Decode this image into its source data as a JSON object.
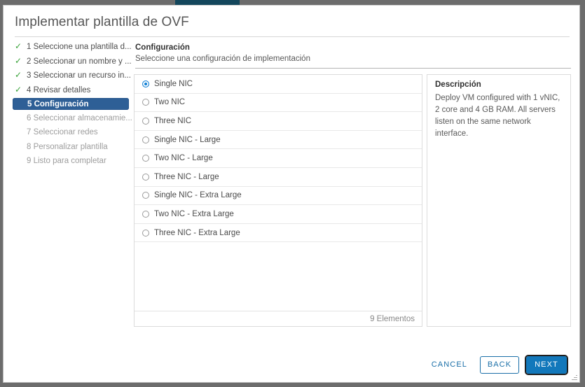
{
  "window": {
    "title": "Implementar plantilla de OVF"
  },
  "steps": [
    {
      "label": "1 Seleccione una plantilla d...",
      "state": "done"
    },
    {
      "label": "2 Seleccionar un nombre y ...",
      "state": "done"
    },
    {
      "label": "3 Seleccionar un recurso in...",
      "state": "done"
    },
    {
      "label": "4 Revisar detalles",
      "state": "done"
    },
    {
      "label": "5 Configuración",
      "state": "current"
    },
    {
      "label": "6 Seleccionar almacenamie...",
      "state": "pending"
    },
    {
      "label": "7 Seleccionar redes",
      "state": "pending"
    },
    {
      "label": "8 Personalizar plantilla",
      "state": "pending"
    },
    {
      "label": "9 Listo para completar",
      "state": "pending"
    }
  ],
  "pane": {
    "title": "Configuración",
    "subtitle": "Seleccione una configuración de implementación"
  },
  "options": {
    "items": [
      {
        "label": "Single NIC",
        "selected": true
      },
      {
        "label": "Two NIC",
        "selected": false
      },
      {
        "label": "Three NIC",
        "selected": false
      },
      {
        "label": "Single NIC - Large",
        "selected": false
      },
      {
        "label": "Two NIC - Large",
        "selected": false
      },
      {
        "label": "Three NIC - Large",
        "selected": false
      },
      {
        "label": "Single NIC - Extra Large",
        "selected": false
      },
      {
        "label": "Two NIC - Extra Large",
        "selected": false
      },
      {
        "label": "Three NIC - Extra Large",
        "selected": false
      }
    ],
    "footer_count": "9 Elementos"
  },
  "description": {
    "title": "Descripción",
    "body": "Deploy VM configured with 1 vNIC, 2 core and 4 GB RAM. All servers listen on the same network interface."
  },
  "footer": {
    "cancel_label": "CANCEL",
    "back_label": "BACK",
    "next_label": "NEXT"
  },
  "colors": {
    "accent": "#1278bb",
    "link": "#1a6fa8",
    "step_current_bg": "#2e5f96",
    "check_green": "#3aa33a",
    "radio_selected": "#0f7fd4",
    "title_bar_tab": "#14475c"
  }
}
